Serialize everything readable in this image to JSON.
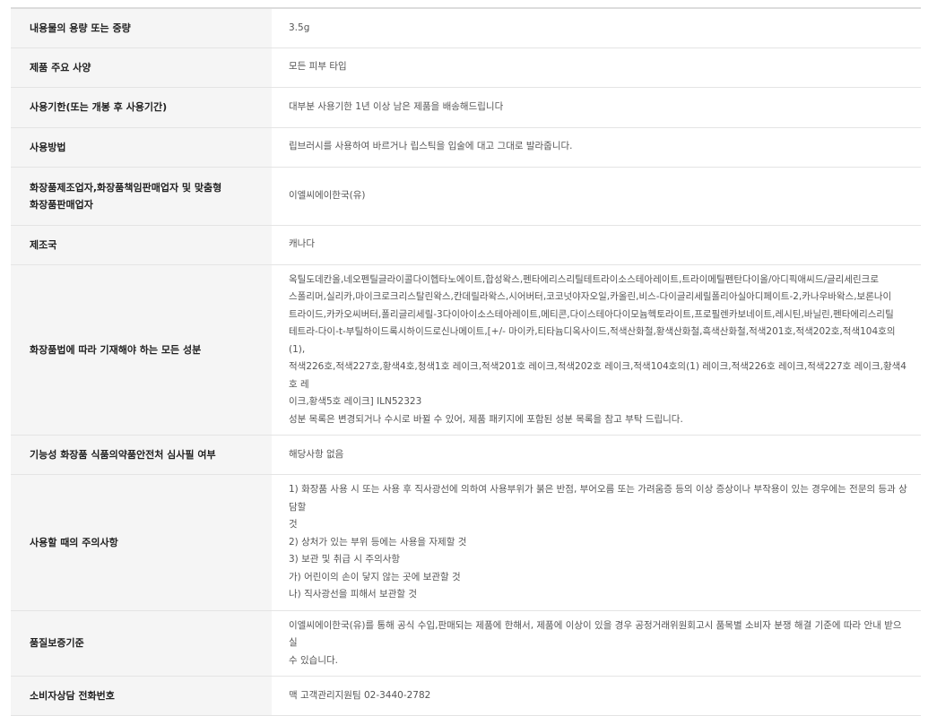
{
  "rows": [
    {
      "label": "내용물의 용량 또는 중량",
      "value": [
        "3.5g"
      ]
    },
    {
      "label": "제품 주요 사양",
      "value": [
        "모든 피부 타입"
      ]
    },
    {
      "label": "사용기한(또는 개봉 후 사용기간)",
      "value": [
        "대부분 사용기한 1년 이상 남은 제품을 배송해드립니다"
      ]
    },
    {
      "label": "사용방법",
      "value": [
        "립브러시를 사용하여 바르거나 립스틱을 입술에 대고 그대로 발라줍니다."
      ]
    },
    {
      "label_lines": [
        "화장품제조업자,화장품책임판매업자 및 맞춤형",
        "화장품판매업자"
      ],
      "value": [
        "이엘씨에이한국(유)"
      ]
    },
    {
      "label": "제조국",
      "value": [
        "캐나다"
      ]
    },
    {
      "label": "화장품법에 따라 기재해야 하는 모든 성분",
      "value": [
        "옥틸도데칸올,네오펜틸글라이콜다이헵타노에이트,합성왁스,펜타에리스리틸테트라이소스테아레이트,트라이메틸펜탄다이올/아디픽애씨드/글리세린크로",
        "스폴리머,실리카,마이크로크리스탈린왁스,칸데릴라왁스,시어버터,코코넛야자오일,카올린,비스-다이글리세릴폴리아실아디페이트-2,카나우바왁스,보론나이",
        "트라이드,카카오씨버터,폴리글리세릴-3다이아이소스테아레이트,메티콘,다이스테아다이모늄헥토라이트,프로필렌카보네이트,레시틴,바닐린,펜타에리스리틸",
        "테트라-다이-t-부틸하이드록시하이드로신나메이트,[+/- 마이카,티타늄디옥사이드,적색산화철,황색산화철,흑색산화철,적색201호,적색202호,적색104호의(1),",
        "적색226호,적색227호,황색4호,청색1호 레이크,적색201호 레이크,적색202호 레이크,적색104호의(1) 레이크,적색226호 레이크,적색227호 레이크,황색4호 레",
        "이크,황색5호 레이크] ILN52323",
        "성분 목록은 변경되거나 수시로 바뀔 수 있어, 제품 패키지에 포함된 성분 목록을 참고 부탁 드립니다."
      ]
    },
    {
      "label": "기능성 화장품 식품의약품안전처 심사필 여부",
      "value": [
        "해당사항 없음"
      ]
    },
    {
      "label": "사용할 때의 주의사항",
      "value": [
        "1) 화장품 사용 시 또는 사용 후 직사광선에 의하여 사용부위가 붉은 반점, 부어오름 또는 가려움증 등의 이상 증상이나 부작용이 있는 경우에는 전문의 등과 상담할",
        "것",
        "2) 상처가 있는 부위 등에는 사용을 자제할 것",
        "3) 보관 및 취급 시 주의사항",
        "가) 어린이의 손이 닿지 않는 곳에 보관할 것",
        "나) 직사광선을 피해서 보관할 것"
      ]
    },
    {
      "label": "품질보증기준",
      "value": [
        "이엘씨에이한국(유)를 통해 공식 수입,판매되는 제품에 한해서, 제품에 이상이 있을 경우 공정거래위원회고시 품목별 소비자 분쟁 해결 기준에 따라 안내 받으실",
        "수 있습니다."
      ]
    },
    {
      "label": "소비자상담 전화번호",
      "value": [
        "맥 고객관리지원팀 02-3440-2782"
      ]
    }
  ]
}
